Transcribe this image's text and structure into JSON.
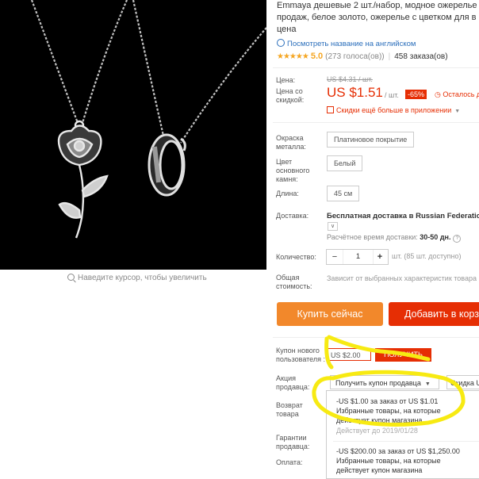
{
  "product": {
    "title_lines": [
      "Emmaya дешевые 2 шт./набор, модное ожерелье",
      "продаж, белое золото, ожерелье с цветком для в",
      "цена"
    ],
    "translate_link": "Посмотреть название на английском",
    "rating": {
      "stars": "★★★★★",
      "score": "5.0",
      "votes": "(273 голоса(ов))",
      "orders": "458 заказа(ов)"
    },
    "zoom_hint": "Наведите курсор, чтобы увеличить"
  },
  "price": {
    "label": "Цена:",
    "old": "US $4.31 / шт.",
    "discount_label": "Цена со скидкой:",
    "new": "US $1.51",
    "unit": "/ шт.",
    "discount_badge": "-65%",
    "time_left": "Осталось дне",
    "app_discount": "Скидки ещё больше в приложении"
  },
  "options": {
    "metal_label": "Окраска металла:",
    "metal_value": "Платиновое покрытие",
    "stone_label": "Цвет основного камня:",
    "stone_value": "Белый",
    "length_label": "Длина:",
    "length_value": "45 см"
  },
  "shipping": {
    "label": "Доставка:",
    "text": "Бесплатная доставка в Russian Federation",
    "time_prefix": "Расчётное время доставки: ",
    "time_value": "30-50 дн.",
    "dropdown_icon": "chevron-down-icon"
  },
  "quantity": {
    "label": "Количество:",
    "minus": "−",
    "value": "1",
    "plus": "+",
    "available": "шт. (85 шт. доступно)"
  },
  "total": {
    "label": "Общая стоимость:",
    "text": "Зависит от выбранных характеристик товара"
  },
  "buttons": {
    "buy_now": "Купить сейчас",
    "add_to_cart": "Добавить в корз"
  },
  "coupons": {
    "new_user_label": "Купон нового пользователя :",
    "new_user_value": "US $2.00",
    "get_label": "ПОЛУЧИТЬ",
    "seller_promo_label": "Акция продавца:",
    "seller_coupon_button": "Получить купон продавца",
    "store_discount_button": "Скидка U",
    "return_label": "Возврат товара",
    "guarantees_label": "Гарантии продавца:",
    "payment_label": "Оплата:",
    "items": [
      {
        "line1": "-US $1.00 за заказ от US $1.01",
        "line2": "Избранные товары, на которые",
        "line3": "действует купон магазина",
        "expiry": "Действует до 2019/01/28"
      },
      {
        "line1": "-US $200.00 за заказ от US $1,250.00",
        "line2": "Избранные товары, на которые",
        "line3": "действует купон магазина",
        "expiry": ""
      }
    ]
  },
  "colors": {
    "accent_red": "#e62e04",
    "buy_orange": "#f2882b",
    "highlight": "#f7ea12",
    "star": "#f5a623"
  }
}
